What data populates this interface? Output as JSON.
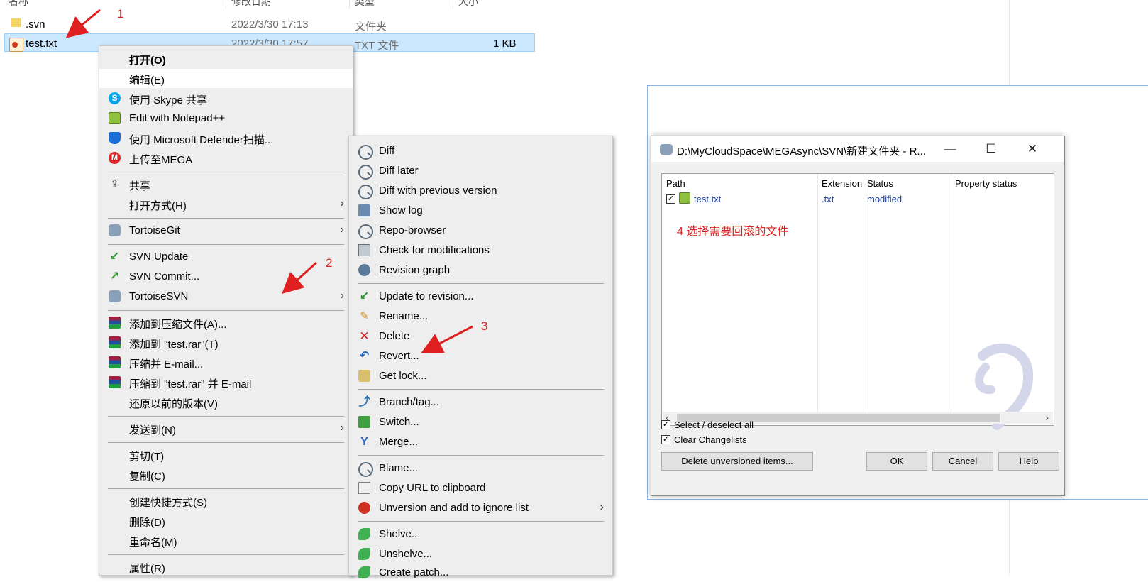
{
  "explorer": {
    "columns": [
      "名称",
      "修改日期",
      "类型",
      "大小"
    ],
    "rows": [
      {
        "name": ".svn",
        "date": "2022/3/30 17:13",
        "type": "文件夹",
        "size": ""
      },
      {
        "name": "test.txt",
        "date": "2022/3/30 17:57",
        "type": "TXT 文件",
        "size": "1 KB"
      }
    ]
  },
  "context_menu": {
    "items": [
      {
        "label": "打开(O)",
        "icon": "none"
      },
      {
        "label": "编辑(E)",
        "icon": "none"
      },
      {
        "label": "使用 Skype 共享",
        "icon": "skype-icon"
      },
      {
        "label": "Edit with Notepad++",
        "icon": "notepad-plus-plus-icon"
      },
      {
        "label": "使用 Microsoft Defender扫描...",
        "icon": "defender-icon"
      },
      {
        "label": "上传至MEGA",
        "icon": "mega-icon"
      },
      {
        "label": "共享",
        "icon": "share-icon"
      },
      {
        "label": "打开方式(H)",
        "icon": "none"
      },
      {
        "label": "TortoiseGit",
        "icon": "tortoisegit-icon"
      },
      {
        "label": "SVN Update",
        "icon": "svn-update-icon"
      },
      {
        "label": "SVN Commit...",
        "icon": "svn-commit-icon"
      },
      {
        "label": "TortoiseSVN",
        "icon": "tortoisesvn-icon"
      },
      {
        "label": "添加到压缩文件(A)...",
        "icon": "winrar-icon"
      },
      {
        "label": "添加到 \"test.rar\"(T)",
        "icon": "winrar-icon"
      },
      {
        "label": "压缩并 E-mail...",
        "icon": "winrar-icon"
      },
      {
        "label": "压缩到 \"test.rar\" 并 E-mail",
        "icon": "winrar-icon"
      },
      {
        "label": "还原以前的版本(V)",
        "icon": "none"
      },
      {
        "label": "发送到(N)",
        "icon": "none"
      },
      {
        "label": "剪切(T)",
        "icon": "none"
      },
      {
        "label": "复制(C)",
        "icon": "none"
      },
      {
        "label": "创建快捷方式(S)",
        "icon": "none"
      },
      {
        "label": "删除(D)",
        "icon": "none"
      },
      {
        "label": "重命名(M)",
        "icon": "none"
      },
      {
        "label": "属性(R)",
        "icon": "none"
      }
    ]
  },
  "svn_menu": {
    "items": [
      {
        "label": "Diff",
        "icon": "diff-icon"
      },
      {
        "label": "Diff later",
        "icon": "diff-later-icon"
      },
      {
        "label": "Diff with previous version",
        "icon": "diff-previous-icon"
      },
      {
        "label": "Show log",
        "icon": "show-log-icon"
      },
      {
        "label": "Repo-browser",
        "icon": "repo-browser-icon"
      },
      {
        "label": "Check for modifications",
        "icon": "check-modifications-icon"
      },
      {
        "label": "Revision graph",
        "icon": "revision-graph-icon"
      },
      {
        "label": "Update to revision...",
        "icon": "update-revision-icon"
      },
      {
        "label": "Rename...",
        "icon": "rename-icon"
      },
      {
        "label": "Delete",
        "icon": "delete-icon"
      },
      {
        "label": "Revert...",
        "icon": "revert-icon"
      },
      {
        "label": "Get lock...",
        "icon": "lock-icon"
      },
      {
        "label": "Branch/tag...",
        "icon": "branch-icon"
      },
      {
        "label": "Switch...",
        "icon": "switch-icon"
      },
      {
        "label": "Merge...",
        "icon": "merge-icon"
      },
      {
        "label": "Blame...",
        "icon": "blame-icon"
      },
      {
        "label": "Copy URL to clipboard",
        "icon": "copy-url-icon"
      },
      {
        "label": "Unversion and add to ignore list",
        "icon": "unversion-icon"
      },
      {
        "label": "Shelve...",
        "icon": "shelve-icon"
      },
      {
        "label": "Unshelve...",
        "icon": "unshelve-icon"
      },
      {
        "label": "Create patch...",
        "icon": "create-patch-icon"
      }
    ]
  },
  "annotations": {
    "n1": "1",
    "n2": "2",
    "n3": "3",
    "n4": "4 选择需要回滚的文件",
    "color": "#e02020"
  },
  "dialog": {
    "title": "D:\\MyCloudSpace\\MEGAsync\\SVN\\新建文件夹 - R...",
    "columns": [
      "Path",
      "Extension",
      "Status",
      "Property status"
    ],
    "row": {
      "path": "test.txt",
      "extension": ".txt",
      "status": "modified",
      "checked": true
    },
    "select_all": "Select / deselect all",
    "clear_changelists": "Clear Changelists",
    "delete_unversioned": "Delete unversioned items...",
    "ok": "OK",
    "cancel": "Cancel",
    "help": "Help"
  }
}
